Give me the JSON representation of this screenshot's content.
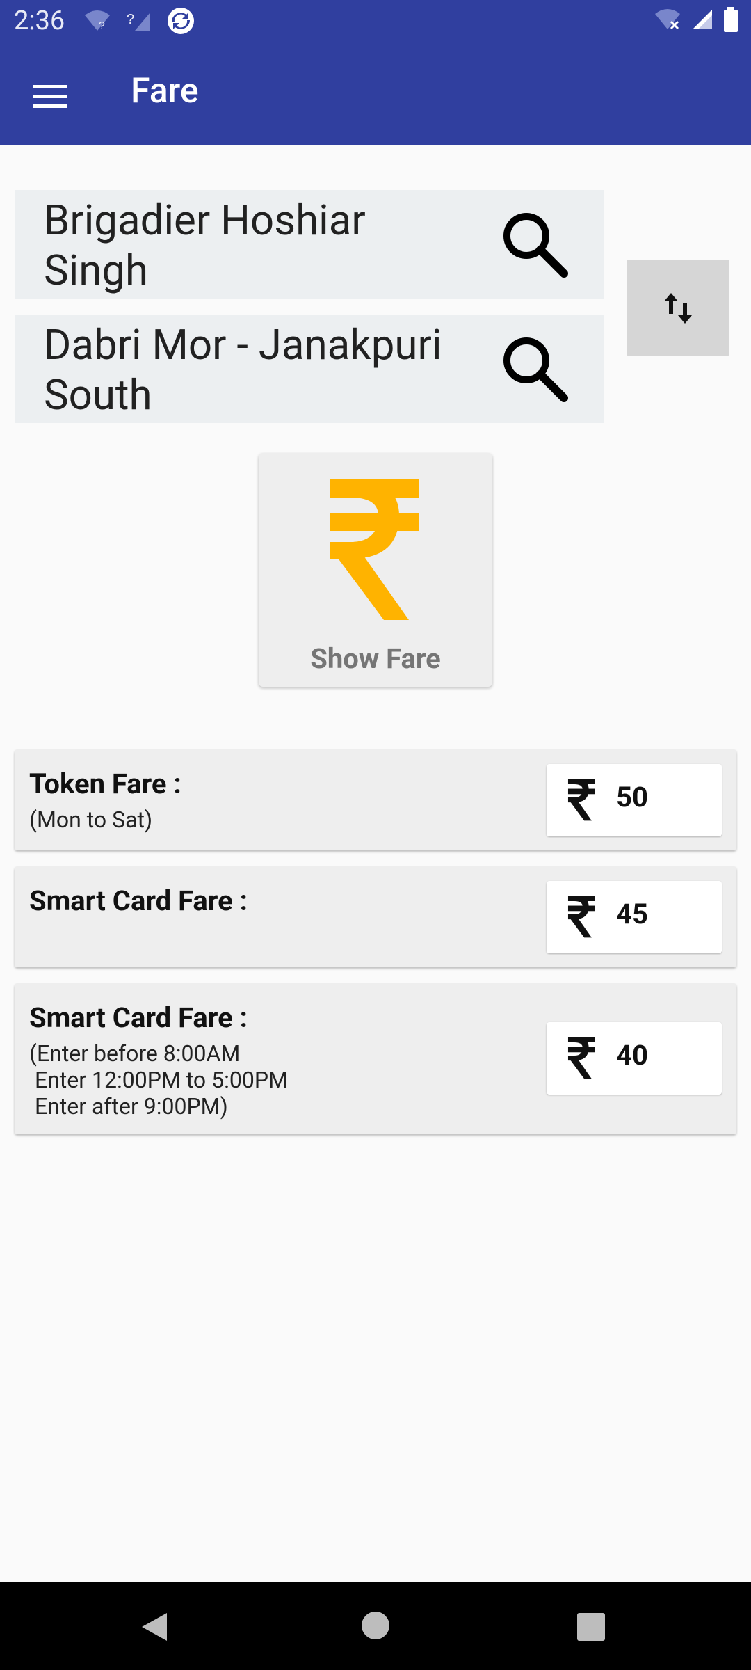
{
  "status": {
    "time": "2:36",
    "icons": [
      "wifi-question-icon",
      "signal-question-icon",
      "sync-icon",
      "wifi-off-icon",
      "signal-icon",
      "battery-icon"
    ]
  },
  "appbar": {
    "title": "Fare",
    "menu_icon": "hamburger-menu-icon"
  },
  "route": {
    "from": "Brigadier Hoshiar Singh",
    "to": "Dabri Mor - Janakpuri South",
    "swap_icon": "swap-vertical-icon",
    "search_icon": "search-icon"
  },
  "show_fare": {
    "label": "Show Fare",
    "icon": "rupee-icon",
    "accent": "#FFB300"
  },
  "fares": [
    {
      "title": "Token Fare :",
      "subtitle": "(Mon to Sat)",
      "amount": "50"
    },
    {
      "title": "Smart Card Fare :",
      "subtitle": "",
      "amount": "45"
    },
    {
      "title": "Smart Card Fare :",
      "subtitle": "(Enter before 8:00AM\n Enter 12:00PM to 5:00PM\n Enter after 9:00PM)",
      "amount": "40"
    }
  ],
  "colors": {
    "primary": "#303F9F",
    "station_bg": "#ECEFF1",
    "card_bg": "#EEEEEE"
  }
}
